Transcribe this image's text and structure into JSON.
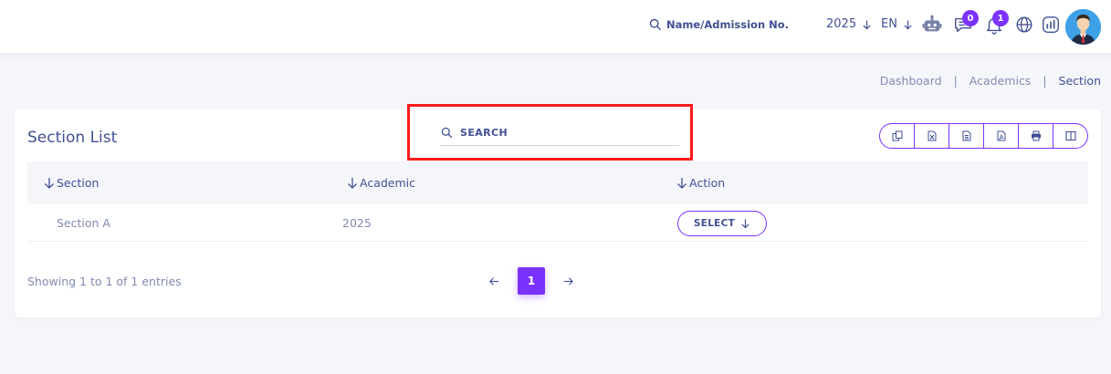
{
  "header": {
    "search_label": "Name/Admission No.",
    "year": "2025",
    "language": "EN",
    "messages_count": "0",
    "notifications_count": "1"
  },
  "breadcrumb": {
    "items": [
      "Dashboard",
      "Academics",
      "Section"
    ]
  },
  "card": {
    "title": "Section List",
    "search_placeholder": "SEARCH",
    "export_buttons": [
      "copy-icon",
      "excel-icon",
      "csv-icon",
      "pdf-icon",
      "print-icon",
      "columns-icon"
    ]
  },
  "table": {
    "columns": [
      "Section",
      "Academic",
      "Action"
    ],
    "rows": [
      {
        "section": "Section A",
        "academic": "2025",
        "action": "SELECT"
      }
    ]
  },
  "footer": {
    "info": "Showing 1 to 1 of 1 entries",
    "current_page": "1"
  },
  "colors": {
    "accent": "#7c32ff",
    "text": "#415094",
    "muted": "#828bb2",
    "highlight_border": "#ff1a1a"
  }
}
